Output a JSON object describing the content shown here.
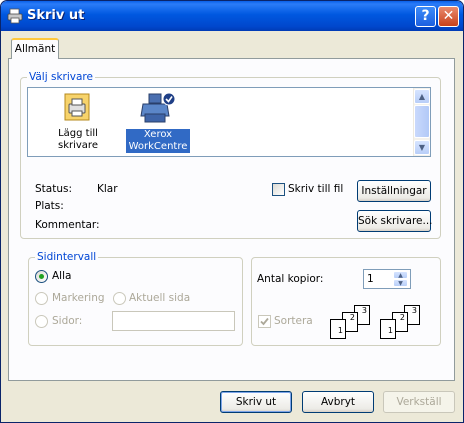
{
  "window": {
    "title": "Skriv ut",
    "help_glyph": "?",
    "close_glyph": "✕"
  },
  "tabs": [
    {
      "label": "Allmänt",
      "selected": true
    }
  ],
  "select_printer": {
    "legend": "Välj skrivare",
    "printers": [
      {
        "label_line1": "Lägg till",
        "label_line2": "skrivare",
        "icon": "add-printer-icon",
        "selected": false
      },
      {
        "label_line1": "Xerox",
        "label_line2": "WorkCentre",
        "icon": "printer-default-icon",
        "selected": true
      }
    ],
    "status_label": "Status:",
    "status_value": "Klar",
    "location_label": "Plats:",
    "location_value": "",
    "comment_label": "Kommentar:",
    "comment_value": "",
    "print_to_file_label": "Skriv till fil",
    "print_to_file_checked": false,
    "preferences_button": "Inställningar",
    "find_printer_button": "Sök skrivare..."
  },
  "page_range": {
    "legend": "Sidintervall",
    "all_label": "Alla",
    "selection_label": "Markering",
    "current_page_label": "Aktuell sida",
    "pages_label": "Sidor:",
    "pages_value": "",
    "selected": "all"
  },
  "copies": {
    "label": "Antal kopior:",
    "value": "1",
    "collate_label": "Sortera",
    "collate_checked": true,
    "collate_page_numbers": [
      "1",
      "2",
      "3"
    ]
  },
  "buttons": {
    "print": "Skriv ut",
    "cancel": "Avbryt",
    "apply": "Verkställ"
  },
  "colors": {
    "titlebar": "#0058e0",
    "legend_text": "#0046d5",
    "selection_highlight": "#316ac5",
    "radio_dot": "#21a121"
  }
}
